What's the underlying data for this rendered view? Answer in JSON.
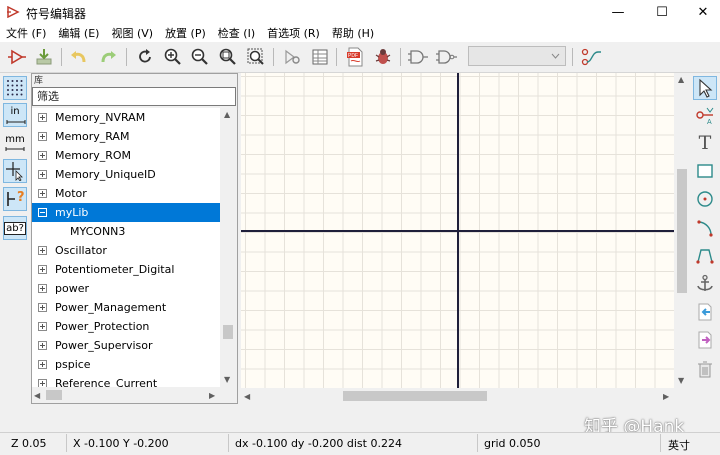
{
  "window": {
    "title": "符号编辑器",
    "controls": {
      "minimize": "—",
      "maximize": "☐",
      "close": "✕"
    }
  },
  "menu": [
    "文件 (F)",
    "编辑 (E)",
    "视图 (V)",
    "放置 (P)",
    "检查 (I)",
    "首选项 (R)",
    "帮助 (H)"
  ],
  "toolbar": {
    "icons": [
      "new-symbol-icon",
      "save-icon",
      "undo-icon",
      "redo-icon",
      "refresh-icon",
      "zoom-in-icon",
      "zoom-out-icon",
      "zoom-fit-icon",
      "zoom-selection-icon",
      "symbol-properties-icon",
      "pin-table-icon",
      "export-pdf-icon",
      "run-erc-icon",
      "de-morgan-standard-icon",
      "de-morgan-alternate-icon",
      "unit-selector",
      "search-library-icon"
    ],
    "pdf_label": "PDF",
    "unit_selector_value": ""
  },
  "left_toolbar": {
    "grid_label": "⠿",
    "inch_label": "in",
    "mm_label": "mm",
    "cursor_label": "+",
    "pin_type_label": "?",
    "hidden_pins_label": "ab?"
  },
  "library": {
    "caption": "库",
    "filter_placeholder": "筛选",
    "items": [
      {
        "name": "Memory_NVRAM",
        "expanded": false
      },
      {
        "name": "Memory_RAM",
        "expanded": false
      },
      {
        "name": "Memory_ROM",
        "expanded": false
      },
      {
        "name": "Memory_UniqueID",
        "expanded": false
      },
      {
        "name": "Motor",
        "expanded": false
      },
      {
        "name": "myLib",
        "expanded": true,
        "selected": true
      },
      {
        "name": "MYCONN3",
        "child": true
      },
      {
        "name": "Oscillator",
        "expanded": false
      },
      {
        "name": "Potentiometer_Digital",
        "expanded": false
      },
      {
        "name": "power",
        "expanded": false
      },
      {
        "name": "Power_Management",
        "expanded": false
      },
      {
        "name": "Power_Protection",
        "expanded": false
      },
      {
        "name": "Power_Supervisor",
        "expanded": false
      },
      {
        "name": "pspice",
        "expanded": false
      },
      {
        "name": "Reference_Current",
        "expanded": false
      }
    ]
  },
  "right_toolbar": {
    "icons": [
      "select-arrow-icon",
      "add-pin-icon",
      "add-text-icon",
      "add-rectangle-icon",
      "add-circle-icon",
      "add-arc-icon",
      "add-polyline-icon",
      "anchor-icon",
      "import-icon",
      "export-icon",
      "delete-icon"
    ],
    "text_label": "T"
  },
  "status": {
    "zoom": "Z 0.05",
    "xy": "X -0.100  Y -0.200",
    "delta": "dx -0.100  dy -0.200  dist 0.224",
    "grid": "grid 0.050",
    "units": "英寸"
  },
  "watermark": "知乎 @Hank",
  "colors": {
    "accent": "#0078d7",
    "canvas_bg": "#fffcf5",
    "grid_line": "#e6e2da",
    "axis": "#1f1f3a",
    "active_tool": "#cde6f7"
  }
}
